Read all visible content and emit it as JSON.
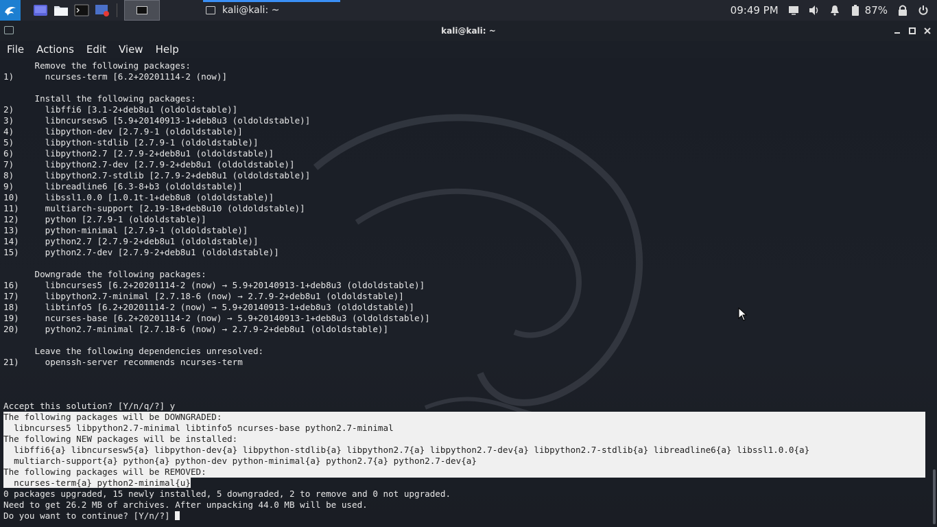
{
  "panel": {
    "task_label": "kali@kali: ~",
    "clock": "09:49 PM",
    "battery": "87%"
  },
  "window": {
    "title": "kali@kali: ~"
  },
  "menu": [
    "File",
    "Actions",
    "Edit",
    "View",
    "Help"
  ],
  "terminal": {
    "lines": [
      "      Remove the following packages:",
      "1)      ncurses-term [6.2+20201114-2 (now)]",
      "",
      "      Install the following packages:",
      "2)      libffi6 [3.1-2+deb8u1 (oldoldstable)]",
      "3)      libncursesw5 [5.9+20140913-1+deb8u3 (oldoldstable)]",
      "4)      libpython-dev [2.7.9-1 (oldoldstable)]",
      "5)      libpython-stdlib [2.7.9-1 (oldoldstable)]",
      "6)      libpython2.7 [2.7.9-2+deb8u1 (oldoldstable)]",
      "7)      libpython2.7-dev [2.7.9-2+deb8u1 (oldoldstable)]",
      "8)      libpython2.7-stdlib [2.7.9-2+deb8u1 (oldoldstable)]",
      "9)      libreadline6 [6.3-8+b3 (oldoldstable)]",
      "10)     libssl1.0.0 [1.0.1t-1+deb8u8 (oldoldstable)]",
      "11)     multiarch-support [2.19-18+deb8u10 (oldoldstable)]",
      "12)     python [2.7.9-1 (oldoldstable)]",
      "13)     python-minimal [2.7.9-1 (oldoldstable)]",
      "14)     python2.7 [2.7.9-2+deb8u1 (oldoldstable)]",
      "15)     python2.7-dev [2.7.9-2+deb8u1 (oldoldstable)]",
      "",
      "      Downgrade the following packages:",
      "16)     libncurses5 [6.2+20201114-2 (now) → 5.9+20140913-1+deb8u3 (oldoldstable)]",
      "17)     libpython2.7-minimal [2.7.18-6 (now) → 2.7.9-2+deb8u1 (oldoldstable)]",
      "18)     libtinfo5 [6.2+20201114-2 (now) → 5.9+20140913-1+deb8u3 (oldoldstable)]",
      "19)     ncurses-base [6.2+20201114-2 (now) → 5.9+20140913-1+deb8u3 (oldoldstable)]",
      "20)     python2.7-minimal [2.7.18-6 (now) → 2.7.9-2+deb8u1 (oldoldstable)]",
      "",
      "      Leave the following dependencies unresolved:",
      "21)     openssh-server recommends ncurses-term",
      "",
      "",
      "",
      "Accept this solution? [Y/n/q/?] y"
    ],
    "highlighted_lines": [
      "The following packages will be DOWNGRADED:",
      "  libncurses5 libpython2.7-minimal libtinfo5 ncurses-base python2.7-minimal",
      "The following NEW packages will be installed:",
      "  libffi6{a} libncursesw5{a} libpython-dev{a} libpython-stdlib{a} libpython2.7{a} libpython2.7-dev{a} libpython2.7-stdlib{a} libreadline6{a} libssl1.0.0{a}",
      "  multiarch-support{a} python{a} python-dev python-minimal{a} python2.7{a} python2.7-dev{a}",
      "The following packages will be REMOVED:"
    ],
    "partial_highlight": "  ncurses-term{a} python2-minimal{u}",
    "tail_lines": [
      "0 packages upgraded, 15 newly installed, 5 downgraded, 2 to remove and 0 not upgraded.",
      "Need to get 26.2 MB of archives. After unpacking 44.0 MB will be used."
    ],
    "prompt": "Do you want to continue? [Y/n/?] "
  },
  "icons": {
    "kali": "kali-dragon-icon",
    "launchers": [
      "workspace-icon",
      "file-manager-icon",
      "terminal-icon",
      "screen-recorder-icon"
    ],
    "tray": [
      "display-icon",
      "volume-icon",
      "notification-bell-icon",
      "battery-icon",
      "lock-icon",
      "power-icon"
    ]
  },
  "colors": {
    "panel_bg": "#23262e",
    "terminal_bg": "#1b1f27",
    "accent": "#3a8ff5",
    "highlight_bg": "#f0f0f0"
  }
}
